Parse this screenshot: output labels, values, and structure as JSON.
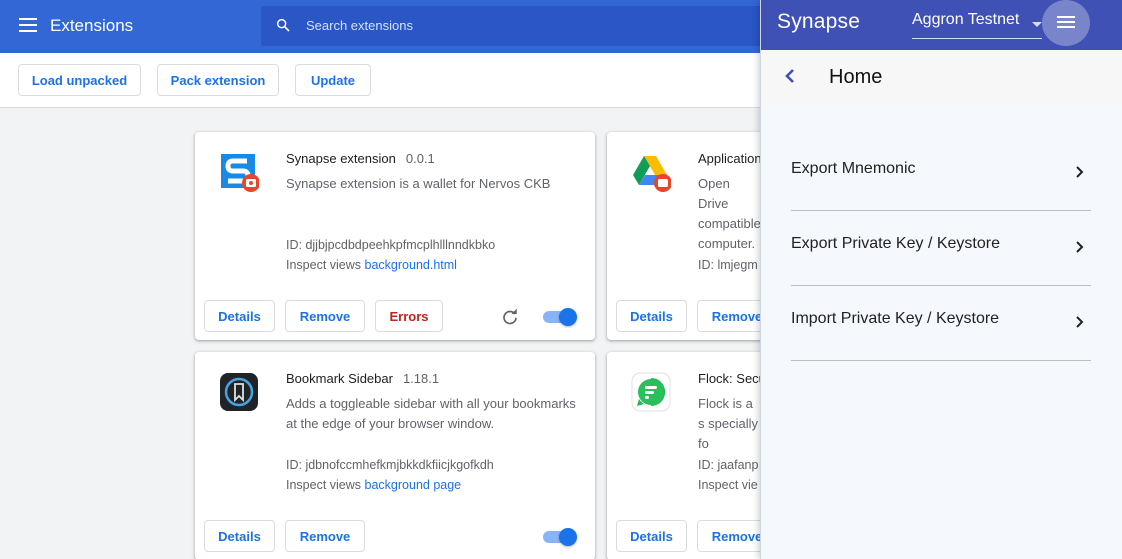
{
  "chrome": {
    "title": "Extensions",
    "search_placeholder": "Search extensions",
    "toolbar": {
      "load_unpacked": "Load unpacked",
      "pack_extension": "Pack extension",
      "update": "Update"
    }
  },
  "cards": [
    {
      "name": "Synapse extension",
      "version": "0.0.1",
      "description": "Synapse extension is a wallet for Nervos CKB",
      "id": "ID: djjbjpcdbdpeehkpfmcplhlllnndkbko",
      "inspect_label": "Inspect views",
      "inspect_link": "background.html",
      "details": "Details",
      "remove": "Remove",
      "errors": "Errors"
    },
    {
      "name": "Application",
      "description": "Open Drive compatible computer.",
      "id": "ID: lmjegm",
      "details": "Details",
      "remove": "Remove"
    },
    {
      "name": "Bookmark Sidebar",
      "version": "1.18.1",
      "description": "Adds a toggleable sidebar with all your bookmarks at the edge of your browser window.",
      "id": "ID: jdbnofccmhefkmjbkkdkfiicjkgofkdh",
      "inspect_label": "Inspect views",
      "inspect_link": "background page",
      "details": "Details",
      "remove": "Remove"
    },
    {
      "name": "Flock: Secu",
      "description": "Flock is a s specially fo",
      "id": "ID: jaafanp",
      "inspect_label": "Inspect vie",
      "details": "Details",
      "remove": "Remove"
    }
  ],
  "popup": {
    "brand": "Synapse",
    "network": "Aggron Testnet",
    "page_title": "Home",
    "menu": [
      {
        "label": "Export Mnemonic"
      },
      {
        "label": "Export Private Key / Keystore"
      },
      {
        "label": "Import Private Key / Keystore"
      }
    ]
  },
  "colors": {
    "chrome_blue": "#3367d6",
    "link_blue": "#1a73e8",
    "popup_header": "#3f51b5",
    "error_red": "#c5221f"
  },
  "icons": [
    "menu-icon",
    "search-icon",
    "synapse-logo-icon",
    "google-drive-icon",
    "bookmark-sidebar-icon",
    "flock-icon",
    "reload-icon",
    "back-icon",
    "chevron-right-icon",
    "hamburger-icon"
  ]
}
